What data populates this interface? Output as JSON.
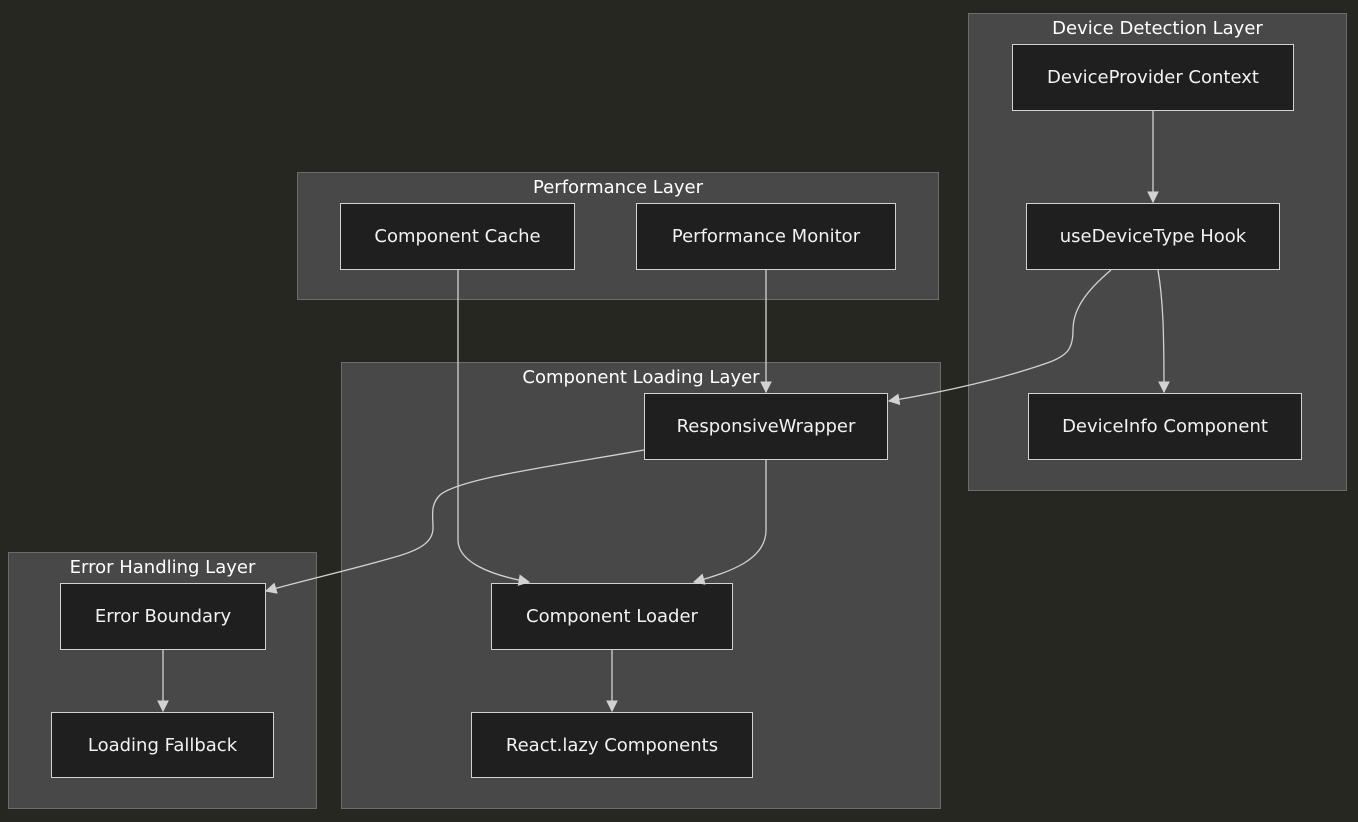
{
  "colors": {
    "background": "#272722",
    "cluster_fill": "#484848",
    "cluster_border": "#6c6c6c",
    "node_fill": "#1f1f1f",
    "node_border": "#d2d2d2",
    "edge": "#d2d2d2",
    "text": "#f2f2f2"
  },
  "clusters": {
    "device_detection": {
      "title": "Device Detection Layer"
    },
    "performance": {
      "title": "Performance Layer"
    },
    "component_loading": {
      "title": "Component Loading Layer"
    },
    "error_handling": {
      "title": "Error Handling Layer"
    }
  },
  "nodes": {
    "device_provider": {
      "label": "DeviceProvider Context"
    },
    "use_device_type": {
      "label": "useDeviceType Hook"
    },
    "device_info": {
      "label": "DeviceInfo Component"
    },
    "component_cache": {
      "label": "Component Cache"
    },
    "performance_monitor": {
      "label": "Performance Monitor"
    },
    "responsive_wrapper": {
      "label": "ResponsiveWrapper"
    },
    "component_loader": {
      "label": "Component Loader"
    },
    "react_lazy": {
      "label": "React.lazy Components"
    },
    "error_boundary": {
      "label": "Error Boundary"
    },
    "loading_fallback": {
      "label": "Loading Fallback"
    }
  },
  "edges": [
    {
      "from": "device_provider",
      "to": "use_device_type"
    },
    {
      "from": "use_device_type",
      "to": "responsive_wrapper"
    },
    {
      "from": "use_device_type",
      "to": "device_info"
    },
    {
      "from": "performance_monitor",
      "to": "responsive_wrapper"
    },
    {
      "from": "component_cache",
      "to": "component_loader"
    },
    {
      "from": "responsive_wrapper",
      "to": "component_loader"
    },
    {
      "from": "responsive_wrapper",
      "to": "error_boundary"
    },
    {
      "from": "component_loader",
      "to": "react_lazy"
    },
    {
      "from": "error_boundary",
      "to": "loading_fallback"
    }
  ]
}
